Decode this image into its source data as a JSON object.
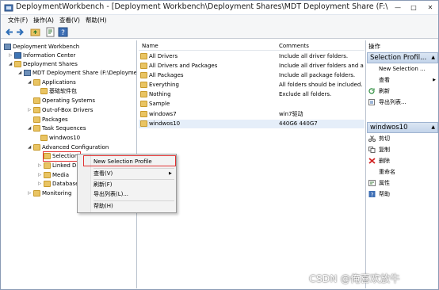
{
  "window": {
    "title": "DeploymentWorkbench - [Deployment Workbench\\Deployment Shares\\MDT Deployment Share (F:\\Deploymen...",
    "controls": {
      "minimize": "—",
      "maximize": "□",
      "close": "✕"
    }
  },
  "menu": [
    "文件(F)",
    "操作(A)",
    "查看(V)",
    "帮助(H)"
  ],
  "tree": {
    "root": "Deployment Workbench",
    "items": [
      "Information Center",
      "Deployment Shares",
      "MDT Deployment Share (F:\\Deployme",
      "Applications",
      "基础软件包",
      "Operating Systems",
      "Out-of-Box Drivers",
      "Packages",
      "Task Sequences",
      "windwos10",
      "Advanced Configuration",
      "Selection",
      "Linked De",
      "Media",
      "Database",
      "Monitoring"
    ]
  },
  "list": {
    "columns": {
      "name": "Name",
      "comments": "Comments"
    },
    "rows": [
      {
        "name": "All Drivers",
        "comments": "Include all driver folders."
      },
      {
        "name": "All Drivers and Packages",
        "comments": "Include all driver folders and a"
      },
      {
        "name": "All Packages",
        "comments": "Include all package folders."
      },
      {
        "name": "Everything",
        "comments": "All folders should be included."
      },
      {
        "name": "Nothing",
        "comments": "Exclude all folders."
      },
      {
        "name": "Sample",
        "comments": ""
      },
      {
        "name": "windows7",
        "comments": "win7驱动"
      },
      {
        "name": "windwos10",
        "comments": "440G6 440G7"
      }
    ]
  },
  "actions": {
    "header": "操作",
    "group1": "Selection Profil...",
    "group1_items": [
      "New Selection ...",
      "查看",
      "刷新",
      "导出列表..."
    ],
    "group2": "windwos10",
    "group2_items": [
      "剪切",
      "复制",
      "删除",
      "重命名",
      "属性",
      "帮助"
    ]
  },
  "context_menu": {
    "items": [
      "New Selection Profile",
      "查看(V)",
      "刷新(F)",
      "导出列表(L)...",
      "帮助(H)"
    ]
  },
  "watermark": "CSDN @俺喜欢放牛",
  "colors": {
    "highlight_box": "#e03030",
    "action_group_bg": "#c3d4ea"
  }
}
